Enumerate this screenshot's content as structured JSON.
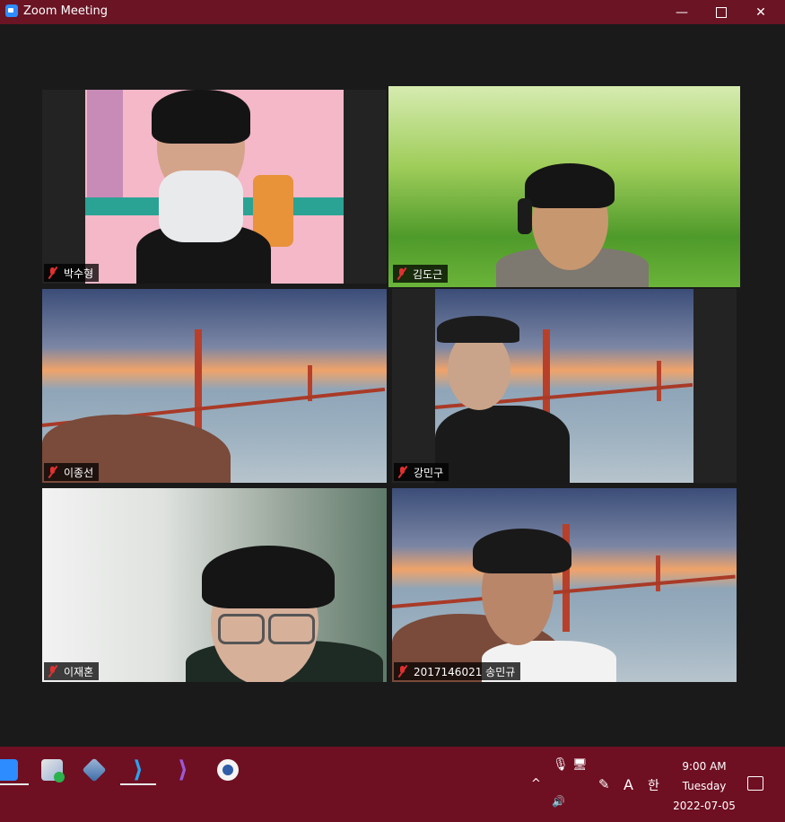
{
  "window": {
    "title": "Zoom Meeting"
  },
  "participants": [
    {
      "name": "박수형",
      "muted": true
    },
    {
      "name": "김도근",
      "muted": true,
      "active_speaker": true
    },
    {
      "name": "이종선",
      "muted": true
    },
    {
      "name": "강민구",
      "muted": true
    },
    {
      "name": "이재혼",
      "muted": true
    },
    {
      "name": "2017146021 송민규",
      "muted": true
    }
  ],
  "taskbar": {
    "apps": [
      "zoom-icon",
      "media-player-icon",
      "virtualbox-icon",
      "vscode-icon",
      "visual-studio-icon",
      "photo-app-icon"
    ],
    "tray": {
      "ime_letter": "A",
      "ime_hangul": "한",
      "time": "9:00 AM",
      "day": "Tuesday",
      "date": "2022-07-05"
    }
  },
  "colors": {
    "titlebar": "#6a1424",
    "taskbar": "#6f0f22",
    "stage": "#1a1a1a",
    "active_outline": "#e9f29a"
  }
}
